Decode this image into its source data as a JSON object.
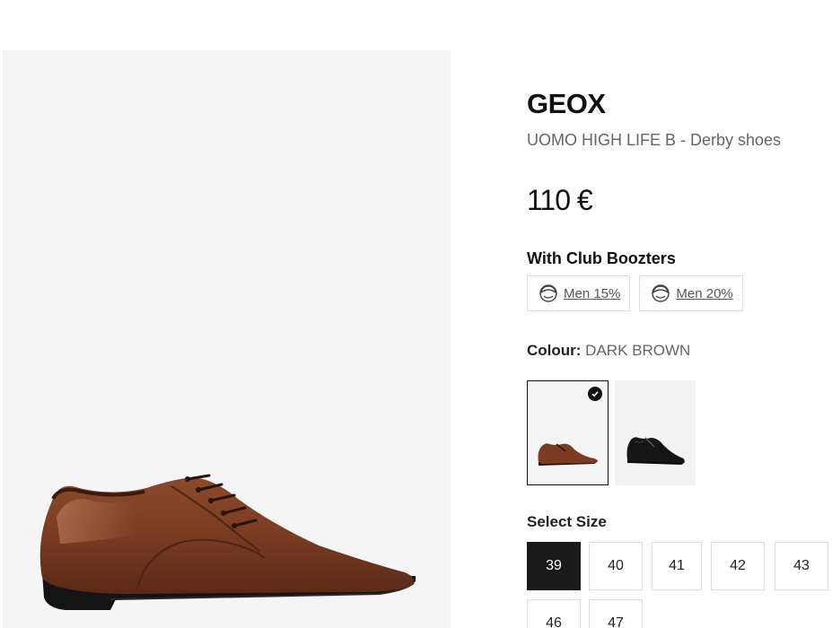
{
  "product": {
    "brand": "GEOX",
    "name": "UOMO HIGH LIFE B - Derby shoes",
    "price": "110 €"
  },
  "club": {
    "title": "With Club Boozters",
    "badges": [
      {
        "label": "Men 15%",
        "icon": "person-face-icon"
      },
      {
        "label": "Men 20%",
        "icon": "person-face-icon"
      }
    ]
  },
  "colour": {
    "label": "Colour:",
    "value": "DARK BROWN",
    "swatches": [
      {
        "name": "dark-brown",
        "color": "#7a3b22",
        "selected": true
      },
      {
        "name": "black",
        "color": "#161616",
        "selected": false
      }
    ]
  },
  "size": {
    "title": "Select Size",
    "options": [
      "39",
      "40",
      "41",
      "42",
      "43",
      "46",
      "47"
    ],
    "selected": "39"
  },
  "colors": {
    "gallery_bg": "#f5f5f5",
    "accent": "#1b1b1b",
    "shoe_brown": "#7a3b22",
    "sole": "#141414"
  }
}
